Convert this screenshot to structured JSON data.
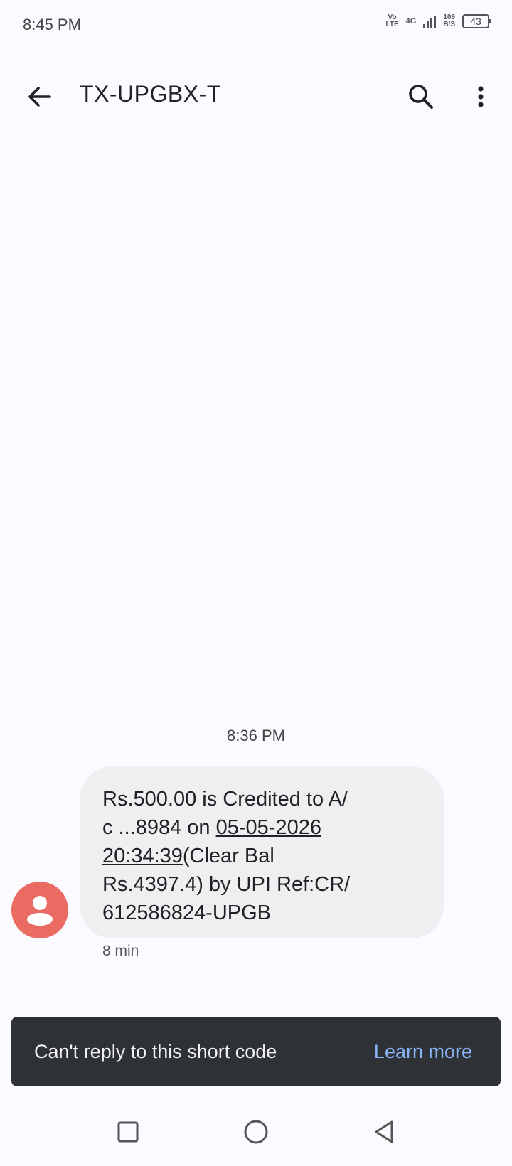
{
  "status": {
    "time": "8:45 PM",
    "volte_top": "Vo",
    "volte_bottom": "LTE",
    "network": "4G",
    "speed_value": "109",
    "speed_unit": "B/S",
    "battery": "43"
  },
  "header": {
    "title": "TX-UPGBX-T",
    "icons": [
      "back-arrow-icon",
      "search-icon",
      "more-vert-icon"
    ]
  },
  "conversation": {
    "timestamp": "8:36 PM",
    "message": {
      "line1": "Rs.500.00 is Credited to A/",
      "line2_prefix": "c ...8984 on ",
      "line2_link": "05-05-2026",
      "line3_link": "20:34:39",
      "line3_suffix": "(Clear Bal",
      "line4": "Rs.4397.4) by UPI Ref:CR/",
      "line5": "612586824-UPGB"
    },
    "age": "8 min"
  },
  "snackbar": {
    "text": "Can't reply to this short code",
    "action": "Learn more"
  },
  "colors": {
    "avatar": "#ea6b62",
    "bubble": "#efeff1",
    "snackbar": "#2e3135",
    "action": "#8ab4f8"
  }
}
